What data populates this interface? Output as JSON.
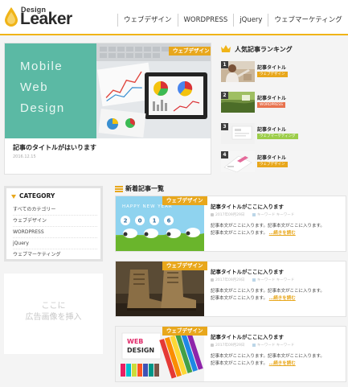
{
  "header": {
    "logo_top": "Design",
    "logo_main": "Leaker",
    "nav": [
      "ウェブデザイン",
      "WORDPRESS",
      "jQuery",
      "ウェブマーケティング"
    ]
  },
  "featured": {
    "hero_lines": [
      "Mobile",
      "Web",
      "Design"
    ],
    "category": "ウェブデザイン",
    "title": "記事のタイトルがはいります",
    "date": "2016.12.15"
  },
  "ranking": {
    "heading": "人気記事ランキング",
    "items": [
      {
        "rank": "1",
        "title": "記事タイトル",
        "category": "ウェブデザイン",
        "tag_color": "#e8a71c"
      },
      {
        "rank": "2",
        "title": "記事タイトル",
        "category": "WORDPRESS",
        "tag_color": "#e8734f"
      },
      {
        "rank": "3",
        "title": "記事タイトル",
        "category": "ウェブマーケティング",
        "tag_color": "#9ccd4a"
      },
      {
        "rank": "4",
        "title": "記事タイトル",
        "category": "ウェブデザイン",
        "tag_color": "#e8a71c"
      }
    ]
  },
  "category": {
    "heading": "CATEGORY",
    "items": [
      "すべてのカテゴリー",
      "ウェブデザイン",
      "WORDPRESS",
      "jQuery",
      "ウェブマーケティング"
    ]
  },
  "ad": {
    "line1": "ここに",
    "line2": "広告画像を挿入"
  },
  "new_posts": {
    "heading": "新着記事一覧",
    "thumb_text": "HAPPY NEW YEAR",
    "thumb_web": "WEB",
    "thumb_design": "DESIGN",
    "items": [
      {
        "category": "ウェブデザイン",
        "title": "記事タイトルがここに入ります",
        "date": "2017年09月29日",
        "tags": "キーワード キーワード",
        "body1": "記事本文がここに入ります。記事本文がここに入ります。",
        "body2": "記事本文がここに入ります。",
        "more": "…続きを読む"
      },
      {
        "category": "ウェブデザイン",
        "title": "記事タイトルがここに入ります",
        "date": "2017年09月29日",
        "tags": "キーワード キーワード",
        "body1": "記事本文がここに入ります。記事本文がここに入ります。",
        "body2": "記事本文がここに入ります。",
        "more": "…続きを読む"
      },
      {
        "category": "ウェブデザイン",
        "title": "記事タイトルがここに入ります",
        "date": "2017年09月29日",
        "tags": "キーワード キーワード",
        "body1": "記事本文がここに入ります。記事本文がここに入ります。",
        "body2": "記事本文がここに入ります。",
        "more": "…続きを読む"
      }
    ]
  }
}
